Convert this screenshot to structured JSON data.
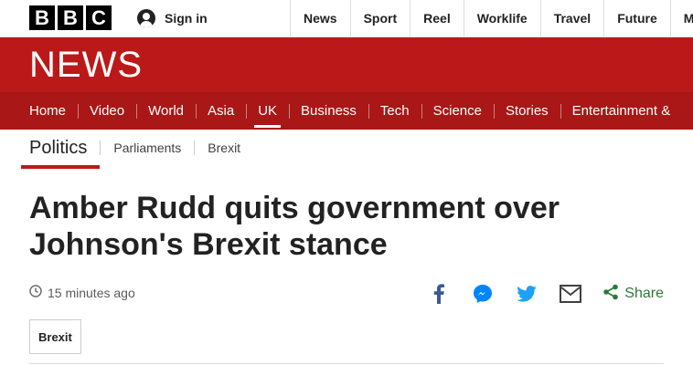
{
  "brand": {
    "letters": [
      "B",
      "B",
      "C"
    ],
    "section_title": "NEWS"
  },
  "account": {
    "signin_label": "Sign in",
    "icon": "user-icon"
  },
  "top_nav": [
    {
      "label": "News"
    },
    {
      "label": "Sport"
    },
    {
      "label": "Reel"
    },
    {
      "label": "Worklife"
    },
    {
      "label": "Travel"
    },
    {
      "label": "Future"
    },
    {
      "label": "Mo"
    }
  ],
  "section_nav": [
    {
      "label": "Home"
    },
    {
      "label": "Video"
    },
    {
      "label": "World"
    },
    {
      "label": "Asia"
    },
    {
      "label": "UK",
      "active": true
    },
    {
      "label": "Business"
    },
    {
      "label": "Tech"
    },
    {
      "label": "Science"
    },
    {
      "label": "Stories"
    },
    {
      "label": "Entertainment &"
    }
  ],
  "sub_nav": {
    "primary": "Politics",
    "items": [
      "Parliaments",
      "Brexit"
    ]
  },
  "article": {
    "headline": "Amber Rudd quits government over Johnson's Brexit stance",
    "timestamp": "15 minutes ago",
    "tag": "Brexit"
  },
  "share": {
    "label": "Share",
    "icons": [
      "facebook-icon",
      "messenger-icon",
      "twitter-icon",
      "email-icon",
      "share-icon"
    ]
  },
  "colors": {
    "brand_red": "#bb1919",
    "nav_red": "#a91717",
    "facebook": "#3b5998",
    "messenger": "#0084ff",
    "twitter": "#1da1f2",
    "share_green": "#2a7b3a"
  }
}
